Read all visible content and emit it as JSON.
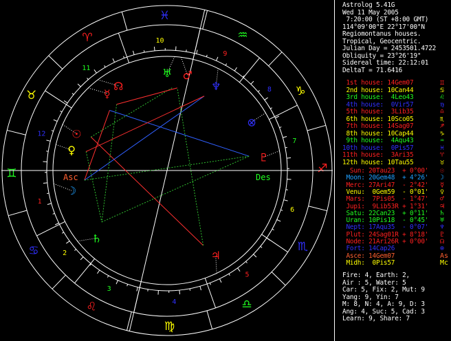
{
  "colors": {
    "background": "#000000",
    "ring": "#ffffff",
    "aspect_square": "#ff3030",
    "aspect_trine": "#3060ff",
    "aspect_sextile": "#30c030"
  },
  "header": [
    "Astrolog 5.41G",
    "Wed 11 May 2005",
    " 7:20:00 (ST +8:00 GMT)",
    "114°09'00\"E 22°17'00\"N",
    "Regiomontanus houses.",
    "Tropical, Geocentric.",
    "Julian Day = 2453501.4722",
    "Obliquity = 23°26'19\"",
    "Sidereal time: 22:12:01",
    "DeltaT = 71.6416"
  ],
  "houses": [
    {
      "label": "1st house:",
      "pos": "14Gem07",
      "sym": "♊",
      "color": "#ff2020"
    },
    {
      "label": "2nd house:",
      "pos": "10Can44",
      "sym": "♋",
      "color": "#ffff00"
    },
    {
      "label": "3rd house:",
      "pos": " 4Leo43",
      "sym": "♌",
      "color": "#20ff20"
    },
    {
      "label": "4th house:",
      "pos": " 0Vir57",
      "sym": "♍",
      "color": "#3030ff"
    },
    {
      "label": "5th house:",
      "pos": " 3Lib35",
      "sym": "♎",
      "color": "#ff2020"
    },
    {
      "label": "6th house:",
      "pos": "10Sco05",
      "sym": "♏",
      "color": "#ffff00"
    },
    {
      "label": "7th house:",
      "pos": "14Sag07",
      "sym": "♐",
      "color": "#ff2020"
    },
    {
      "label": "8th house:",
      "pos": "10Cap44",
      "sym": "♑",
      "color": "#ffff00"
    },
    {
      "label": "9th house:",
      "pos": " 4Aqu43",
      "sym": "♒",
      "color": "#20ff20"
    },
    {
      "label": "10th house:",
      "pos": " 0Pis57",
      "sym": "♓",
      "color": "#3030ff"
    },
    {
      "label": "11th house:",
      "pos": " 3Ari35",
      "sym": "♈",
      "color": "#ff2020"
    },
    {
      "label": "12th house:",
      "pos": "10Tau55",
      "sym": "♉",
      "color": "#ffff00"
    }
  ],
  "planets": [
    {
      "name": "Sun:",
      "pos": "20Tau23",
      "lat": "+ 0°00'",
      "sym": "☉",
      "color": "#ff2020"
    },
    {
      "name": "Moon:",
      "pos": "20Gem48",
      "lat": "+ 4°26'",
      "sym": "☽",
      "color": "#20a0ff"
    },
    {
      "name": "Merc:",
      "pos": "27Ari47",
      "lat": "- 2°42'",
      "sym": "☿",
      "color": "#ff2020"
    },
    {
      "name": "Venu:",
      "pos": " 0Gem59",
      "lat": "- 0°01'",
      "sym": "♀",
      "color": "#ffff00"
    },
    {
      "name": "Mars:",
      "pos": " 7Pis05",
      "lat": "- 1°47'",
      "sym": "♂",
      "color": "#ff2020"
    },
    {
      "name": "Jupi:",
      "pos": " 9Lib53R",
      "lat": "+ 1°31'",
      "sym": "♃",
      "color": "#ff2020"
    },
    {
      "name": "Satu:",
      "pos": "22Can23",
      "lat": "+ 0°11'",
      "sym": "♄",
      "color": "#20ff20"
    },
    {
      "name": "Uran:",
      "pos": "10Pis18",
      "lat": "- 0°45'",
      "sym": "♅",
      "color": "#20ff20"
    },
    {
      "name": "Nept:",
      "pos": "17Aqu35",
      "lat": "- 0°07'",
      "sym": "♆",
      "color": "#3030ff"
    },
    {
      "name": "Plut:",
      "pos": "24Sag01R",
      "lat": "+ 8°18'",
      "sym": "♇",
      "color": "#ff2020"
    },
    {
      "name": "Node:",
      "pos": "21Ari26R",
      "lat": "+ 0°00'",
      "sym": "☊",
      "color": "#ff2020"
    },
    {
      "name": "Fort:",
      "pos": "14Cap26",
      "lat": "",
      "sym": "⊗",
      "color": "#3030ff"
    },
    {
      "name": "Asce:",
      "pos": "14Gem07",
      "lat": "",
      "sym": "As",
      "color": "#ff6030"
    },
    {
      "name": "Midh:",
      "pos": " 0Pis57",
      "lat": "",
      "sym": "Mc",
      "color": "#ffff00"
    }
  ],
  "stats": [
    "Fire: 4, Earth: 2,",
    "Air : 5, Water: 5",
    "Car: 5, Fix: 2, Mut: 9",
    "Yang: 9, Yin: 7",
    "M: 8, N: 4, A: 9, D: 3",
    "Ang: 4, Suc: 5, Cad: 3",
    "Learn: 9, Share: 7"
  ],
  "wheel_labels": {
    "asc": "Asc",
    "des": "Des",
    "house_numbers": [
      "1",
      "2",
      "3",
      "4",
      "5",
      "6",
      "7",
      "8",
      "9",
      "10",
      "11",
      "12"
    ]
  }
}
